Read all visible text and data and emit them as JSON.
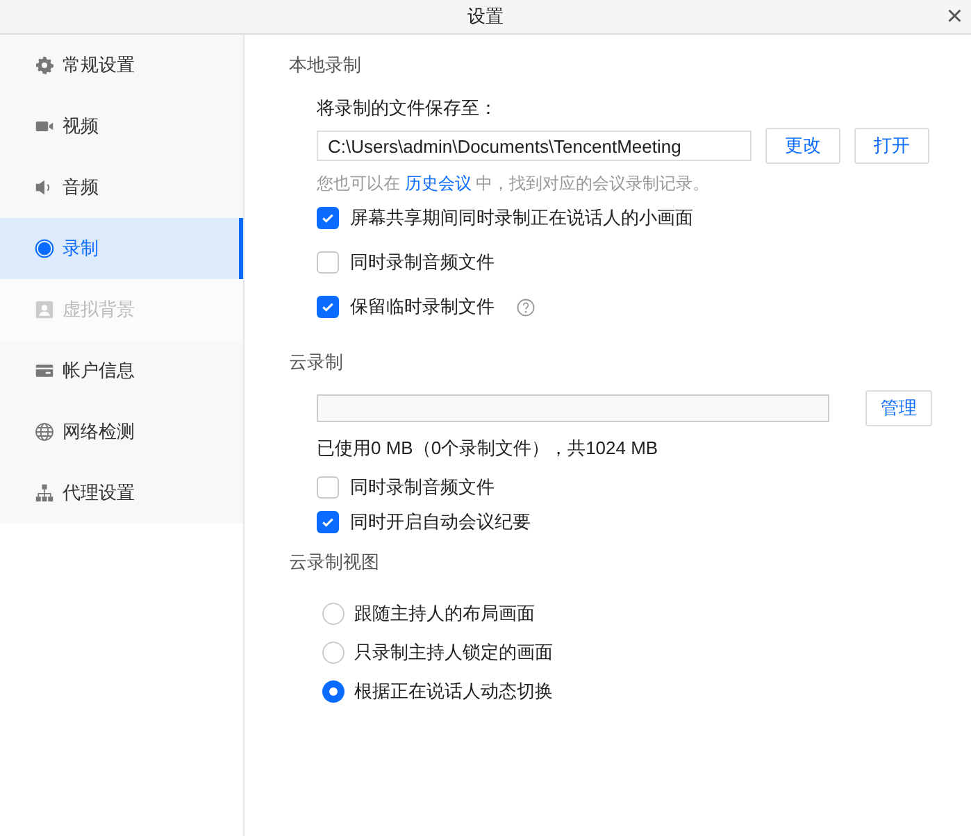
{
  "window": {
    "title": "设置",
    "close": "×"
  },
  "sidebar": {
    "items": [
      {
        "kind": "gear",
        "label": "常规设置",
        "selected": false,
        "disabled": false
      },
      {
        "kind": "camera",
        "label": "视频",
        "selected": false,
        "disabled": false
      },
      {
        "kind": "speaker",
        "label": "音频",
        "selected": false,
        "disabled": false
      },
      {
        "kind": "record",
        "label": "录制",
        "selected": true,
        "disabled": false
      },
      {
        "kind": "person",
        "label": "虚拟背景",
        "selected": false,
        "disabled": true
      },
      {
        "kind": "card",
        "label": "帐户信息",
        "selected": false,
        "disabled": false
      },
      {
        "kind": "globe",
        "label": "网络检测",
        "selected": false,
        "disabled": false
      },
      {
        "kind": "network",
        "label": "代理设置",
        "selected": false,
        "disabled": false
      }
    ]
  },
  "local_recording": {
    "title": "本地录制",
    "save_label": "将录制的文件保存至：",
    "path": "C:\\Users\\admin\\Documents\\TencentMeeting",
    "buttons": [
      "更改",
      "打开"
    ],
    "hint_before": "您也可以在",
    "hint_link": "历史会议",
    "hint_after": "中，找到对应的会议录制记录。",
    "options": [
      {
        "label": "屏幕共享期间同时录制正在说话人的小画面",
        "checked": true,
        "help": false
      },
      {
        "label": "同时录制音频文件",
        "checked": false,
        "help": false
      },
      {
        "label": "保留临时录制文件",
        "checked": true,
        "help": true
      }
    ]
  },
  "cloud_recording": {
    "title": "云录制",
    "storage": {
      "level": 0
    },
    "manage_button": "管理",
    "usage": "已使用0 MB（0个录制文件），共1024 MB",
    "options": [
      {
        "label": "同时录制音频文件",
        "checked": false
      },
      {
        "label": "同时开启自动会议纪要",
        "checked": true
      }
    ]
  },
  "cloud_view": {
    "title": "云录制视图",
    "options": [
      {
        "label": "跟随主持人的布局画面",
        "selected": false
      },
      {
        "label": "只录制主持人锁定的画面",
        "selected": false
      },
      {
        "label": "根据正在说话人动态切换",
        "selected": true
      }
    ]
  }
}
